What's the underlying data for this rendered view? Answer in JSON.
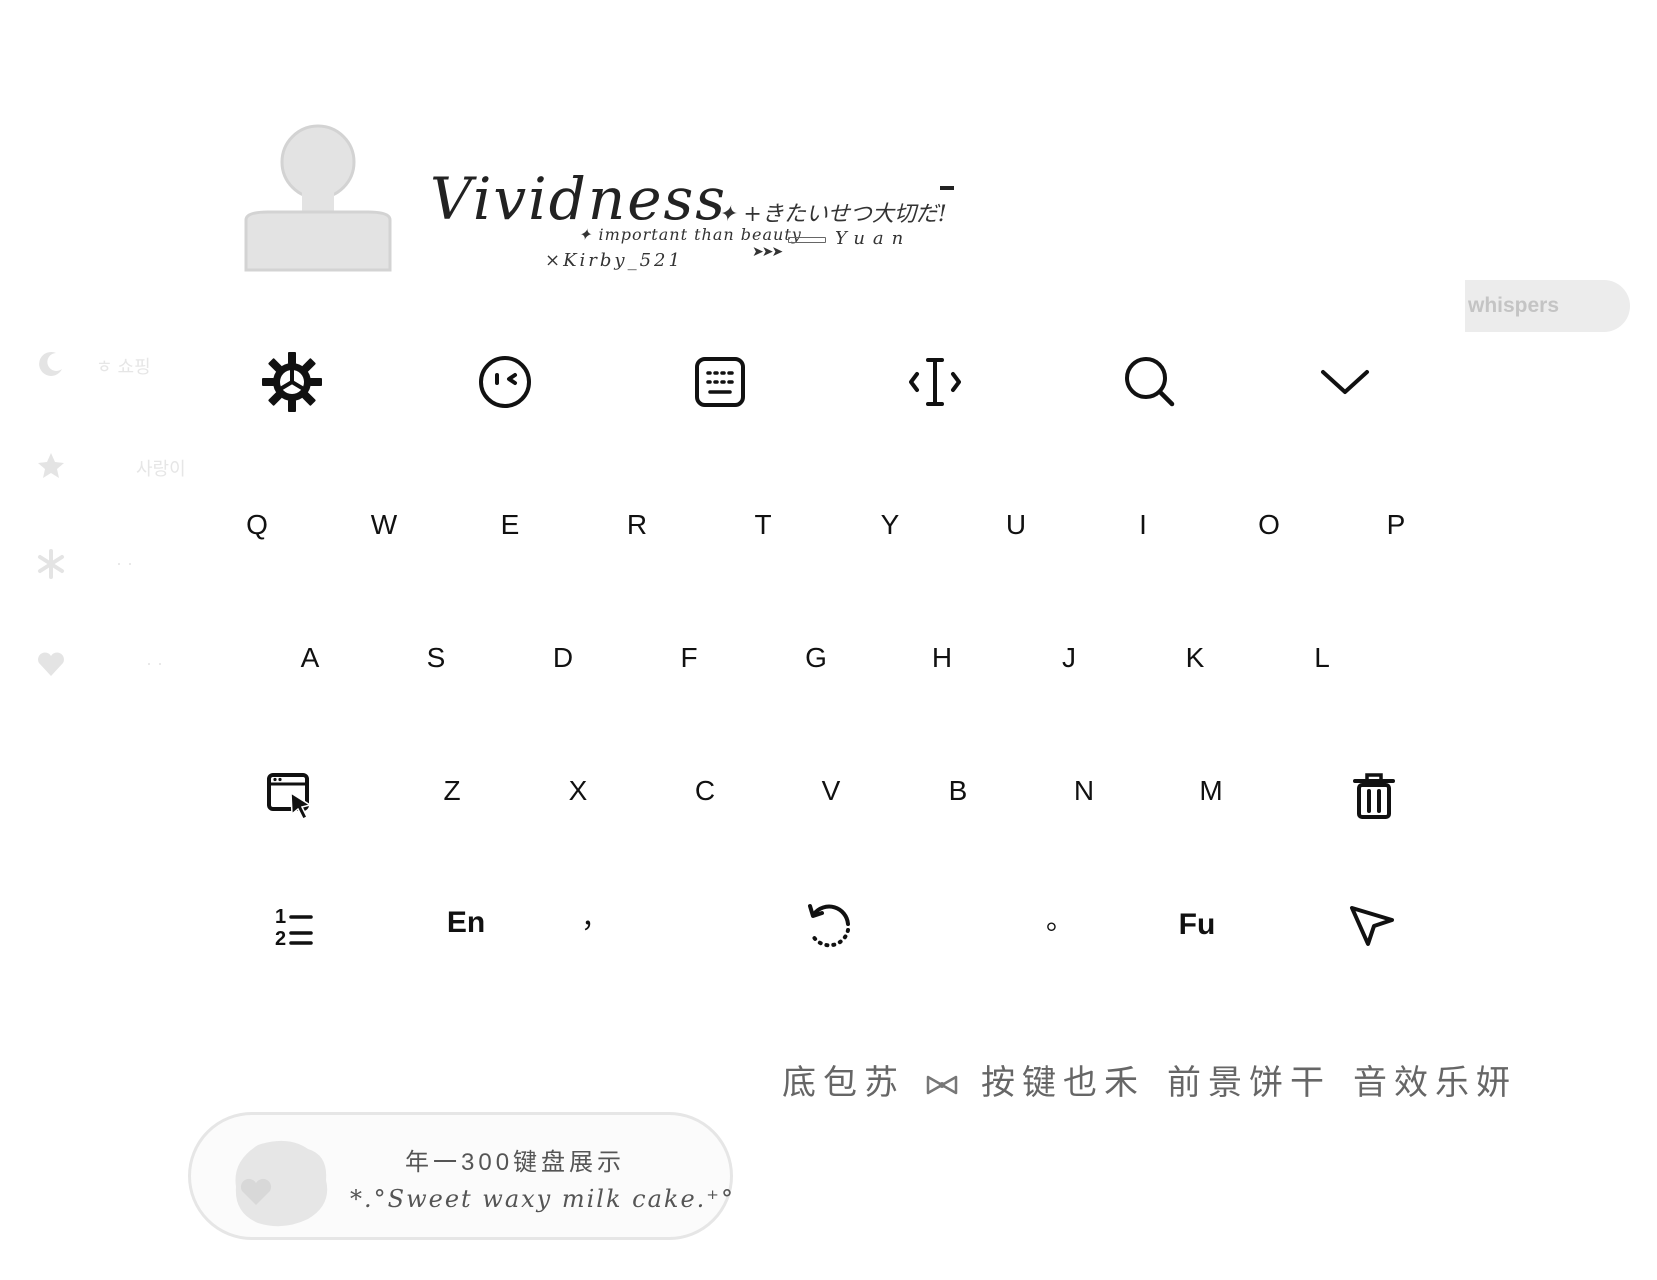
{
  "banner": {
    "title": "Vividness",
    "japanese": "✦ +きたいせつ大切だ!",
    "subtitle": "✦ important than beauty",
    "signature": "×Kirby_521",
    "name": "Yuan",
    "arrows": "➤➤➤"
  },
  "side_tab": {
    "label": "whispers"
  },
  "side_menu": [
    {
      "icon": "moon-icon",
      "label": "ㅎ 쇼핑"
    },
    {
      "icon": "star-icon",
      "label": "사랑이"
    },
    {
      "icon": "snowflake-icon",
      "label": "·  ·"
    },
    {
      "icon": "heart-icon",
      "label": "·  ·"
    }
  ],
  "toolbar": [
    {
      "icon": "gear-icon"
    },
    {
      "icon": "emoji-face-icon"
    },
    {
      "icon": "keyboard-layout-icon"
    },
    {
      "icon": "text-cursor-icon"
    },
    {
      "icon": "search-icon"
    },
    {
      "icon": "collapse-chevron-icon"
    }
  ],
  "keyboard": {
    "row1": [
      "Q",
      "W",
      "E",
      "R",
      "T",
      "Y",
      "U",
      "I",
      "O",
      "P"
    ],
    "row2": [
      "A",
      "S",
      "D",
      "F",
      "G",
      "H",
      "J",
      "K",
      "L"
    ],
    "row3": [
      "Z",
      "X",
      "C",
      "V",
      "B",
      "N",
      "M"
    ],
    "row4": {
      "lang": "En",
      "comma": "，",
      "period": "。",
      "fu": "Fu"
    },
    "icons": [
      "clipboard-cursor-icon",
      "delete-icon",
      "numbers-icon",
      "undo-icon",
      "send-icon"
    ]
  },
  "credits": [
    "底包苏",
    "按键也禾",
    "前景饼干",
    "音效乐妍"
  ],
  "card": {
    "title": "年一300键盘展示",
    "subtitle": "*.°Sweet waxy milk cake.⁺°"
  }
}
